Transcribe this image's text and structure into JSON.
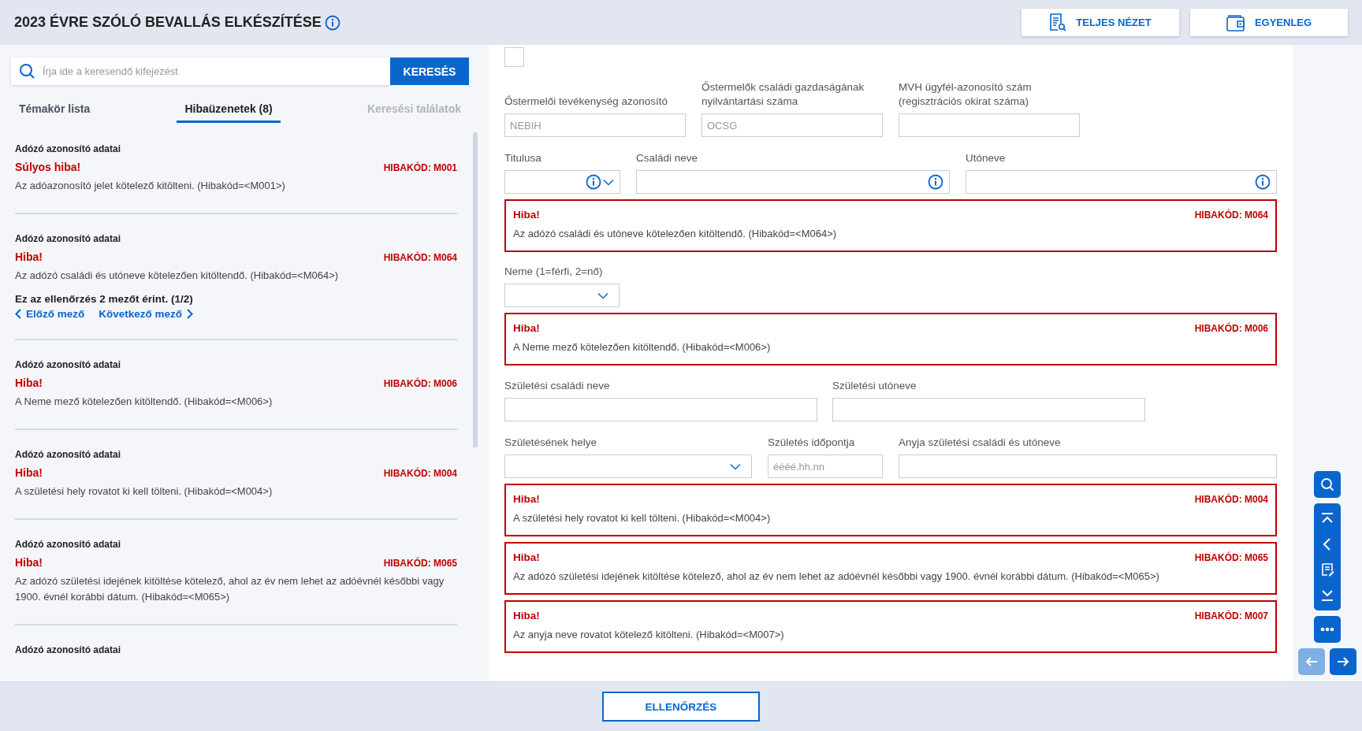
{
  "header": {
    "title": "2023 ÉVRE SZÓLÓ BEVALLÁS ELKÉSZÍTÉSE",
    "buttons": [
      {
        "label": "TELJES NÉZET",
        "kind": "document-search"
      },
      {
        "label": "EGYENLEG",
        "kind": "wallet"
      }
    ]
  },
  "sidebar": {
    "search": {
      "placeholder": "Írja ide a keresendő kifejezést",
      "button": "KERESÉS"
    },
    "tabs": [
      {
        "label": "Témakör lista",
        "selected": false,
        "disabled": false
      },
      {
        "label": "Hibaüzenetek (8)",
        "selected": true,
        "disabled": false
      },
      {
        "label": "Keresési találatok",
        "selected": false,
        "disabled": true
      }
    ],
    "errors": [
      {
        "section": "Adózó azonosító adatai",
        "severity": "Súlyos hiba!",
        "code": "HIBAKÓD: M001",
        "message": "Az adóazonosító jelet kötelező kitölteni. (Hibakód=<M001>)"
      },
      {
        "section": "Adózó azonosító adatai",
        "severity": "Hiba!",
        "code": "HIBAKÓD: M064",
        "message": "Az adózó családi és utóneve kötelezően kitöltendő. (Hibakód=<M064>)",
        "affects": "Ez az ellenőrzés 2 mezőt érint. (1/2)",
        "prev": "Előző mező",
        "next": "Következő mező"
      },
      {
        "section": "Adózó azonosító adatai",
        "severity": "Hiba!",
        "code": "HIBAKÓD: M006",
        "message": "A Neme mező kötelezően kitöltendő. (Hibakód=<M006>)"
      },
      {
        "section": "Adózó azonosító adatai",
        "severity": "Hiba!",
        "code": "HIBAKÓD: M004",
        "message": "A születési hely rovatot ki kell tölteni. (Hibakód=<M004>)"
      },
      {
        "section": "Adózó azonosító adatai",
        "severity": "Hiba!",
        "code": "HIBAKÓD: M065",
        "message": "Az adózó születési idejének kitöltése kötelező, ahol az év nem lehet az adóévnél későbbi vagy 1900. évnél korábbi dátum. (Hibakód=<M065>)"
      },
      {
        "section": "Adózó azonosító adatai"
      }
    ]
  },
  "form": {
    "checkbox": {
      "checked": false
    },
    "blocks": [
      {
        "kind": "row",
        "fields": [
          {
            "label": "Őstermelői tevékenység azonosító",
            "kind": "text",
            "placeholder": "NEBIH",
            "info": false
          },
          {
            "label": "Őstermelők családi gazdaságának nyilvántartási száma",
            "kind": "text",
            "placeholder": "OCSG",
            "info": false
          },
          {
            "label": "MVH ügyfél-azonosító szám (regisztrációs okirat száma)",
            "kind": "text",
            "info": false
          }
        ]
      },
      {
        "kind": "row",
        "fields": [
          {
            "label": "Titulusa",
            "kind": "select",
            "info": true
          },
          {
            "label": "Családi neve",
            "kind": "text",
            "info": true
          },
          {
            "label": "Utóneve",
            "kind": "text",
            "info": true
          }
        ]
      },
      {
        "kind": "error",
        "title": "Hiba!",
        "code": "HIBAKÓD: M064",
        "message": "Az adózó családi és utóneve kötelezően kitöltendő. (Hibakód=<M064>)"
      },
      {
        "kind": "row",
        "fields": [
          {
            "label": "Neme (1=férfi, 2=nő)",
            "kind": "select",
            "info": false
          }
        ]
      },
      {
        "kind": "error",
        "title": "Hiba!",
        "code": "HIBAKÓD: M006",
        "message": "A Neme mező kötelezően kitöltendő. (Hibakód=<M006>)"
      },
      {
        "kind": "row",
        "fields": [
          {
            "label": "Születési családi neve",
            "kind": "text",
            "info": false
          },
          {
            "label": "Születési utóneve",
            "kind": "text",
            "info": false
          }
        ]
      },
      {
        "kind": "row",
        "fields": [
          {
            "label": "Születésének helye",
            "kind": "select",
            "info": false
          },
          {
            "label": "Születés időpontja",
            "kind": "text",
            "placeholder": "éééé.hh.nn",
            "info": false
          },
          {
            "label": "Anyja születési családi és utóneve",
            "kind": "text",
            "info": false
          }
        ]
      },
      {
        "kind": "error",
        "title": "Hiba!",
        "code": "HIBAKÓD: M004",
        "message": "A születési hely rovatot ki kell tölteni. (Hibakód=<M004>)"
      },
      {
        "kind": "error",
        "title": "Hiba!",
        "code": "HIBAKÓD: M065",
        "message": "Az adózó születési idejének kitöltése kötelező, ahol az év nem lehet az adóévnél későbbi vagy 1900. évnél korábbi dátum. (Hibakód=<M065>)"
      },
      {
        "kind": "error",
        "title": "Hiba!",
        "code": "HIBAKÓD: M007",
        "message": "Az anyja neve rovatot kötelező kitölteni. (Hibakód=<M007>)"
      }
    ]
  },
  "rail": {
    "arrows": [
      {
        "kind": "back",
        "disabled": true
      },
      {
        "kind": "forward",
        "disabled": false
      }
    ]
  },
  "footer": {
    "button": "ELLENŐRZÉS"
  }
}
